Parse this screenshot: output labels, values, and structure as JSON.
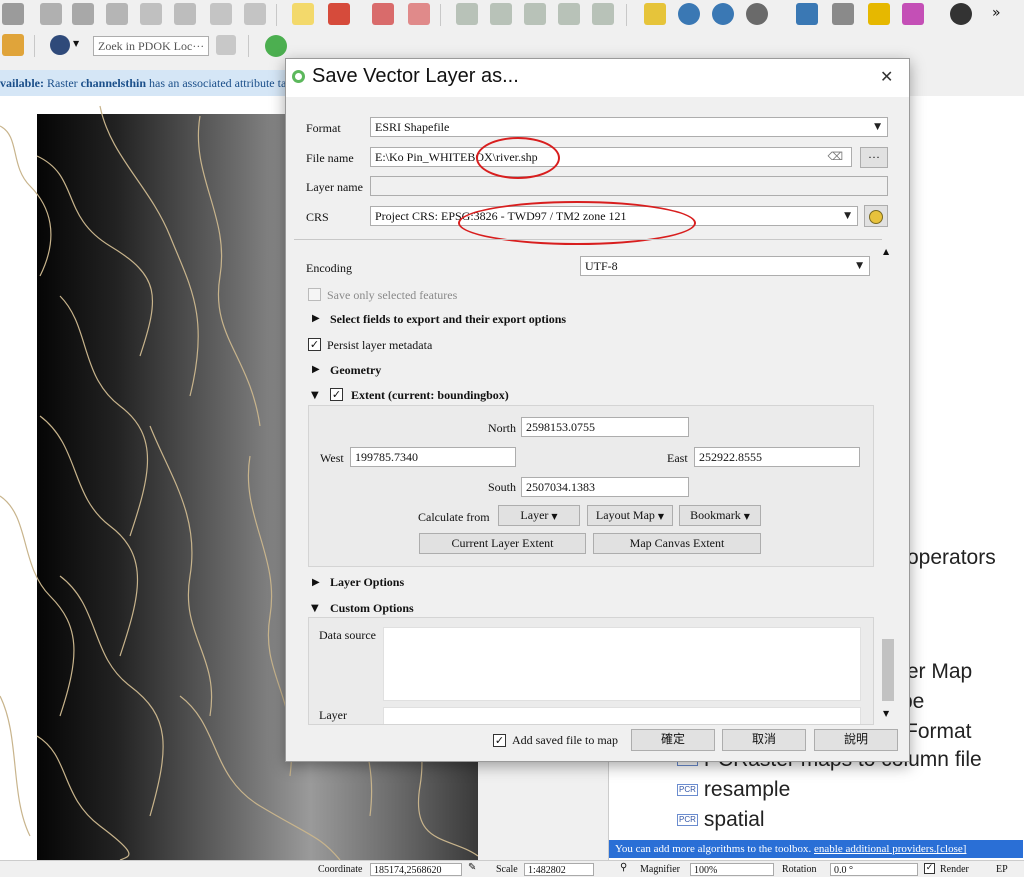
{
  "toolbar": {
    "search_placeholder": "Zoek in PDOK Loc···",
    "more": "»"
  },
  "info_bar": {
    "prefix": "vailable:",
    "text1": "Raster",
    "layer": "channelsthin",
    "text2": "has an associated attribute tab"
  },
  "dialog": {
    "title": "Save Vector Layer as...",
    "close": "✕",
    "format_label": "Format",
    "format_value": "ESRI Shapefile",
    "filename_label": "File name",
    "filename_value": "E:\\Ko Pin_WHITEBOX\\river.shp",
    "browse": "···",
    "layername_label": "Layer name",
    "layername_value": "",
    "crs_label": "CRS",
    "crs_value": "Project CRS: EPSG:3826 - TWD97 / TM2 zone 121",
    "encoding_label": "Encoding",
    "encoding_value": "UTF-8",
    "save_selected_label": "Save only selected features",
    "select_fields_label": "Select fields to export and their export options",
    "persist_label": "Persist layer metadata",
    "geometry_label": "Geometry",
    "extent_label": "Extent (current: boundingbox)",
    "north_label": "North",
    "north_value": "2598153.0755",
    "west_label": "West",
    "west_value": "199785.7340",
    "east_label": "East",
    "east_value": "252922.8555",
    "south_label": "South",
    "south_value": "2507034.1383",
    "calculate_from_label": "Calculate from",
    "layer_btn": "Layer",
    "layout_map_btn": "Layout Map",
    "bookmark_btn": "Bookmark",
    "current_extent_btn": "Current Layer Extent",
    "map_canvas_extent_btn": "Map Canvas Extent",
    "layer_options_label": "Layer Options",
    "custom_options_label": "Custom Options",
    "datasource_label": "Data source",
    "layer_label": "Layer",
    "add_saved_label": "Add saved file to map",
    "ok_btn": "確定",
    "cancel_btn": "取消",
    "help_btn": "說明"
  },
  "right_panel": {
    "items": [
      "operators",
      "ter Map",
      "pe",
      "Format",
      "PCRaster maps to column file",
      "resample",
      "spatial"
    ],
    "provider_text": "You can add more algorithms to the toolbox.",
    "provider_link": "enable additional providers.",
    "provider_close": "[close]"
  },
  "status_bar": {
    "coordinate_label": "Coordinate",
    "coordinate_value": "185174,2568620",
    "scale_label": "Scale",
    "scale_value": "1:482802",
    "magnifier_label": "Magnifier",
    "magnifier_value": "100%",
    "rotation_label": "Rotation",
    "rotation_value": "0.0 °",
    "render_label": "Render",
    "epsg_label": "EP"
  },
  "colors": {
    "accent_blue": "#2a6fd6",
    "annotation_red": "#d81e1e",
    "dem_grey": "#8a8a8a",
    "river_tan": "#c8b48c"
  }
}
